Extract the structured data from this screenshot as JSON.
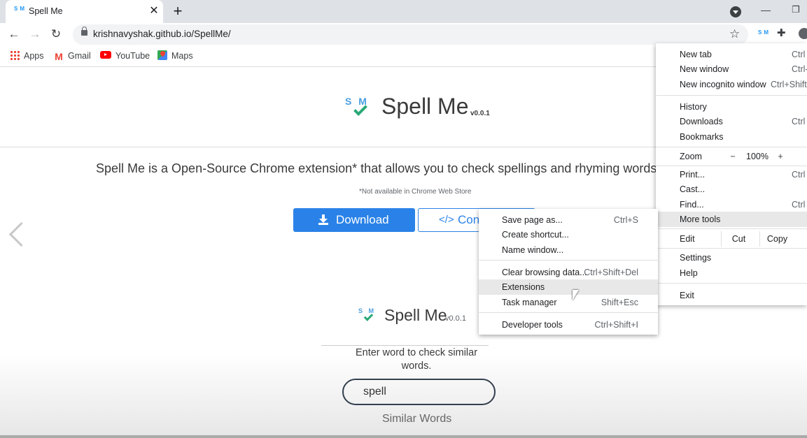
{
  "browser": {
    "tab": {
      "title": "Spell Me",
      "favicon": "SM"
    },
    "new_tab": "+",
    "address": "krishnavyshak.github.io/SpellMe/",
    "extension_icon": "SM",
    "bookmarks": [
      "Apps",
      "Gmail",
      "YouTube",
      "Maps"
    ]
  },
  "page": {
    "logo_letters": "S M",
    "title": "Spell Me",
    "version": "v0.0.1",
    "description": "Spell Me is a Open-Source Chrome extension* that allows you to check spellings and rhyming words a",
    "note": "*Not available in Chrome Web Store",
    "download_label": "Download",
    "contribute_label": "Con",
    "popup": {
      "logo_letters": "S M",
      "title": "Spell Me",
      "version": "v0.0.1",
      "prompt": "Enter word to check similar words.",
      "input_value": "spell",
      "similar_label": "Similar Words"
    }
  },
  "main_menu": {
    "new_tab": {
      "label": "New tab",
      "shortcut": "Ctrl"
    },
    "new_window": {
      "label": "New window",
      "shortcut": "Ctrl-"
    },
    "new_incognito": {
      "label": "New incognito window",
      "shortcut": "Ctrl+Shift-"
    },
    "history": {
      "label": "History"
    },
    "downloads": {
      "label": "Downloads",
      "shortcut": "Ctrl"
    },
    "bookmarks": {
      "label": "Bookmarks"
    },
    "zoom": {
      "label": "Zoom",
      "minus": "−",
      "value": "100%",
      "plus": "+"
    },
    "print": {
      "label": "Print...",
      "shortcut": "Ctrl"
    },
    "cast": {
      "label": "Cast..."
    },
    "find": {
      "label": "Find...",
      "shortcut": "Ctrl"
    },
    "more_tools": {
      "label": "More tools"
    },
    "edit": {
      "label": "Edit",
      "cut": "Cut",
      "copy": "Copy"
    },
    "settings": {
      "label": "Settings"
    },
    "help": {
      "label": "Help"
    },
    "exit": {
      "label": "Exit"
    }
  },
  "sub_menu": {
    "save_page": {
      "label": "Save page as...",
      "shortcut": "Ctrl+S"
    },
    "create_shortcut": {
      "label": "Create shortcut..."
    },
    "name_window": {
      "label": "Name window..."
    },
    "clear_browsing": {
      "label": "Clear browsing data...",
      "shortcut": "Ctrl+Shift+Del"
    },
    "extensions": {
      "label": "Extensions"
    },
    "task_manager": {
      "label": "Task manager",
      "shortcut": "Shift+Esc"
    },
    "developer_tools": {
      "label": "Developer tools",
      "shortcut": "Ctrl+Shift+I"
    }
  }
}
